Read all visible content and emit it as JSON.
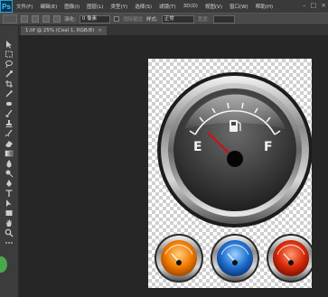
{
  "app": {
    "logo": "Ps"
  },
  "menu": {
    "items": [
      "文件(F)",
      "编辑(E)",
      "图像(I)",
      "图层(L)",
      "类型(Y)",
      "选择(S)",
      "滤镜(T)",
      "3D(D)",
      "视图(V)",
      "窗口(W)",
      "帮助(H)"
    ]
  },
  "options": {
    "feather_label": "羽化:",
    "feather_value": "0 像素",
    "antialias_label": "消除锯齿",
    "style_label": "样式:",
    "style_value": "正常",
    "width_label": "宽度:"
  },
  "document": {
    "tab_title": "1.tif @ 25% (Ceal 1, RGB/8)",
    "close_label": "×"
  },
  "gauge": {
    "empty_label": "E",
    "full_label": "F"
  },
  "colors": {
    "foreground": "#e00000",
    "background": "#ffffff",
    "small_gauges": [
      "#f07a00",
      "#1f6fd0",
      "#d82a0a"
    ]
  },
  "toolbar": {
    "icons": [
      "move-icon",
      "marquee-icon",
      "lasso-icon",
      "quick-select-icon",
      "crop-icon",
      "eyedropper-icon",
      "healing-brush-icon",
      "brush-icon",
      "clone-stamp-icon",
      "history-brush-icon",
      "eraser-icon",
      "gradient-icon",
      "blur-icon",
      "dodge-icon",
      "pen-icon",
      "type-icon",
      "path-select-icon",
      "shape-icon",
      "hand-icon",
      "zoom-icon"
    ]
  }
}
